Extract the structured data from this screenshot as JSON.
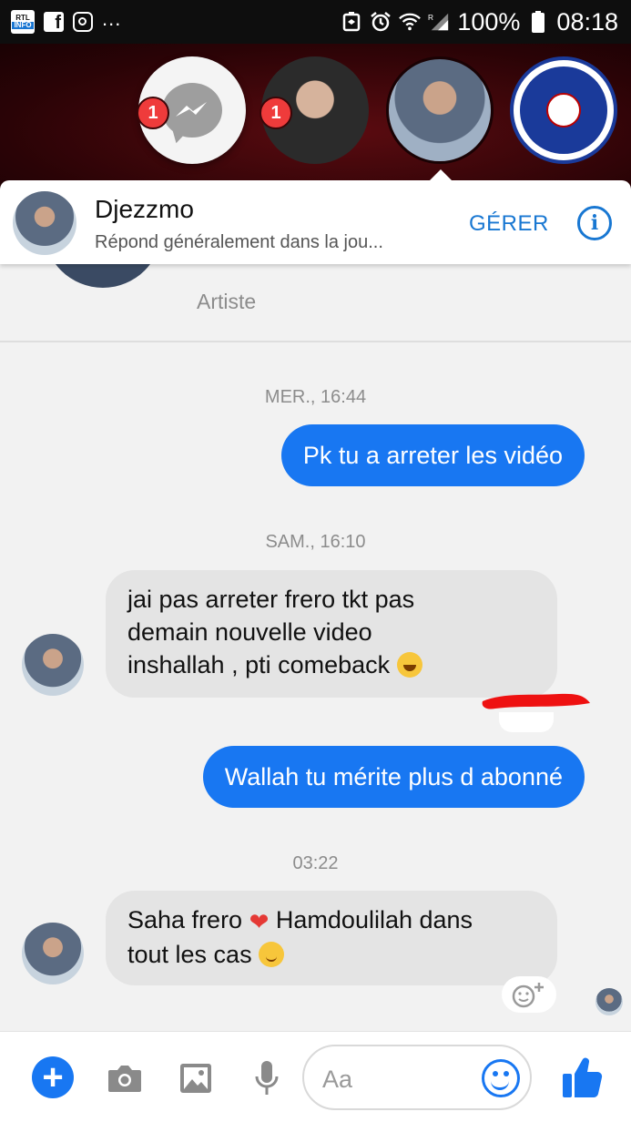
{
  "status_bar": {
    "notif_app_top": "RTL",
    "notif_app_bottom": "INFO",
    "notif_fb": "f",
    "more": "...",
    "battery": "100%",
    "time": "08:18",
    "icons": [
      "rtl-info-app-icon",
      "facebook-icon",
      "instagram-icon",
      "nfc-icon",
      "alarm-icon",
      "wifi-icon",
      "signal-icon",
      "battery-icon"
    ]
  },
  "chat_heads": {
    "badge_messenger": "1",
    "badge_contact": "1",
    "heads": [
      "messenger-head",
      "contact-head",
      "djezzmo-head",
      "football-club-head"
    ]
  },
  "header": {
    "name": "Djezzmo",
    "subtitle": "Répond généralement dans la jou...",
    "manage_label": "GÉRER",
    "info_glyph": "i"
  },
  "profile_peek": {
    "role": "Artiste"
  },
  "messages": [
    {
      "type": "timestamp",
      "text": "MER., 16:44"
    },
    {
      "type": "outgoing",
      "text": "Pk tu a arreter les vidéo"
    },
    {
      "type": "timestamp",
      "text": "SAM., 16:10"
    },
    {
      "type": "incoming",
      "lines": [
        "jai pas arreter frero tkt pas",
        "demain nouvelle video",
        "inshallah , pti comeback"
      ],
      "emoji": "grinning-emoji"
    },
    {
      "type": "outgoing",
      "text": "Wallah tu mérite plus d abonné"
    },
    {
      "type": "timestamp",
      "text": "03:22"
    },
    {
      "type": "incoming",
      "line1_a": "Saha frero",
      "line1_b": "Hamdoulilah dans",
      "line2": "tout les cas",
      "emoji": "wink-emoji"
    }
  ],
  "composer": {
    "plus": "+",
    "placeholder": "Aa",
    "icons": [
      "plus-icon",
      "camera-icon",
      "image-icon",
      "microphone-icon",
      "emoji-icon",
      "thumbs-up-icon"
    ]
  },
  "colors": {
    "accent": "#1877f2",
    "badge": "#ef3b3b",
    "heads_bg": "#2a0306",
    "incoming_bubble": "#e4e4e4"
  }
}
